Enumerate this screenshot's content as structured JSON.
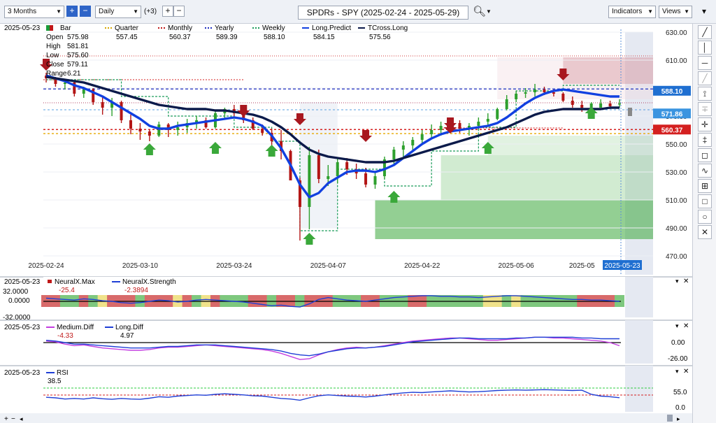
{
  "toolbar": {
    "period": "3 Months",
    "interval": "Daily",
    "extra": "(+3)",
    "symbol": "SPDRs - SPY (2025-02-24 - 2025-05-29)",
    "indicators_label": "Indicators",
    "views_label": "Views"
  },
  "legend": {
    "date": "2025-05-23",
    "bar_label": "Bar",
    "open_label": "Open",
    "open": "575.98",
    "high_label": "High",
    "high": "581.81",
    "low_label": "Low",
    "low": "575.60",
    "close_label": "Close",
    "close": "579.11",
    "range_label": "Range",
    "range": "6.21",
    "items": [
      {
        "name": "Quarter",
        "value": "557.45",
        "color": "#d6a600"
      },
      {
        "name": "Monthly",
        "value": "560.37",
        "color": "#c01818"
      },
      {
        "name": "Yearly",
        "value": "589.39",
        "color": "#1f2fbf"
      },
      {
        "name": "Weekly",
        "value": "588.10",
        "color": "#1b9c5a"
      },
      {
        "name": "Long.Predict",
        "value": "584.15",
        "color": "#1140e0"
      },
      {
        "name": "TCross.Long",
        "value": "575.56",
        "color": "#0b1a4a"
      }
    ]
  },
  "price_axis": [
    "630.00",
    "610.00",
    "590.00",
    "570.00",
    "550.00",
    "530.00",
    "510.00",
    "490.00",
    "470.00"
  ],
  "price_tags": [
    {
      "label": "588.10",
      "color": "#1f6fd1"
    },
    {
      "label": "571.86",
      "color": "#3a94e0"
    },
    {
      "label": "560.37",
      "color": "#d42020"
    }
  ],
  "date_axis": [
    "2025-02-24",
    "2025-03-10",
    "2025-03-24",
    "2025-04-07",
    "2025-04-22",
    "2025-05-06",
    "2025-05"
  ],
  "date_cursor": "2025-05-23",
  "panels": {
    "neural": {
      "date": "2025-05-23",
      "max_name": "NeuralX.Max",
      "max_value": "-25.4",
      "strength_name": "NeuralX.Strength",
      "strength_value": "-2.3894",
      "axis": [
        "32.0000",
        "0.0000",
        "-32.0000"
      ]
    },
    "diff": {
      "date": "2025-05-23",
      "medium_name": "Medium.Diff",
      "medium_value": "-4.33",
      "long_name": "Long.Diff",
      "long_value": "4.97",
      "axis": [
        "0.00",
        "-26.00"
      ]
    },
    "rsi": {
      "date": "2025-05-23",
      "name": "RSI",
      "value": "38.5",
      "axis": [
        "55.0",
        "0.0"
      ]
    }
  },
  "chart_data": {
    "type": "candlestick",
    "title": "SPDRs - SPY (2025-02-24 - 2025-05-29)",
    "ylim": [
      470,
      630
    ],
    "dates": [
      "2025-02-24",
      "2025-03-10",
      "2025-03-24",
      "2025-04-07",
      "2025-04-22",
      "2025-05-06",
      "2025-05-23"
    ],
    "bar_count": 62,
    "ohlc": [
      [
        599,
        601,
        594,
        597
      ],
      [
        597,
        598,
        591,
        593
      ],
      [
        593,
        596,
        589,
        594
      ],
      [
        594,
        595,
        584,
        586
      ],
      [
        586,
        591,
        583,
        589
      ],
      [
        589,
        590,
        578,
        580
      ],
      [
        580,
        584,
        571,
        576
      ],
      [
        576,
        583,
        570,
        580
      ],
      [
        580,
        581,
        565,
        567
      ],
      [
        567,
        571,
        557,
        561
      ],
      [
        561,
        565,
        553,
        559
      ],
      [
        559,
        560,
        552,
        556
      ],
      [
        556,
        566,
        555,
        564
      ],
      [
        564,
        565,
        555,
        560
      ],
      [
        560,
        566,
        556,
        562
      ],
      [
        562,
        568,
        558,
        565
      ],
      [
        565,
        570,
        561,
        567
      ],
      [
        567,
        569,
        561,
        562
      ],
      [
        562,
        574,
        561,
        572
      ],
      [
        572,
        576,
        568,
        575
      ],
      [
        575,
        578,
        570,
        572
      ],
      [
        572,
        573,
        565,
        567
      ],
      [
        567,
        569,
        560,
        561
      ],
      [
        561,
        564,
        556,
        558
      ],
      [
        558,
        561,
        548,
        552
      ],
      [
        552,
        560,
        539,
        545
      ],
      [
        545,
        546,
        525,
        524
      ],
      [
        524,
        526,
        481,
        505
      ],
      [
        505,
        548,
        489,
        542
      ],
      [
        542,
        546,
        522,
        525
      ],
      [
        525,
        535,
        520,
        527
      ],
      [
        527,
        540,
        522,
        537
      ],
      [
        537,
        540,
        528,
        532
      ],
      [
        532,
        536,
        525,
        529
      ],
      [
        529,
        533,
        519,
        521
      ],
      [
        521,
        530,
        518,
        527
      ],
      [
        527,
        541,
        525,
        539
      ],
      [
        539,
        548,
        535,
        546
      ],
      [
        546,
        552,
        541,
        549
      ],
      [
        549,
        555,
        544,
        553
      ],
      [
        553,
        560,
        550,
        557
      ],
      [
        557,
        564,
        554,
        560
      ],
      [
        560,
        566,
        556,
        563
      ],
      [
        563,
        567,
        558,
        565
      ],
      [
        565,
        567,
        558,
        561
      ],
      [
        561,
        565,
        556,
        563
      ],
      [
        563,
        569,
        560,
        566
      ],
      [
        566,
        572,
        563,
        568
      ],
      [
        568,
        576,
        567,
        575
      ],
      [
        575,
        585,
        574,
        582
      ],
      [
        582,
        588,
        580,
        586
      ],
      [
        586,
        590,
        583,
        587
      ],
      [
        587,
        593,
        584,
        589
      ],
      [
        589,
        591,
        585,
        587
      ],
      [
        587,
        589,
        584,
        586
      ],
      [
        586,
        587,
        580,
        581
      ],
      [
        581,
        584,
        576,
        578
      ],
      [
        578,
        581,
        573,
        576
      ],
      [
        576,
        580,
        573,
        579
      ],
      [
        576,
        582,
        576,
        579
      ],
      [
        579,
        581,
        575,
        577
      ],
      [
        579,
        582,
        576,
        579
      ]
    ],
    "series": [
      {
        "name": "Long.Predict",
        "values": [
          599,
          597,
          595,
          592,
          590,
          587,
          584,
          580,
          576,
          572,
          568,
          563,
          561,
          561,
          563,
          564,
          565,
          566,
          567,
          568,
          569,
          568,
          566,
          563,
          556,
          547,
          535,
          521,
          512,
          515,
          522,
          526,
          530,
          531,
          531,
          530,
          532,
          535,
          540,
          545,
          550,
          554,
          557,
          559,
          560,
          561,
          562,
          563,
          565,
          569,
          574,
          579,
          583,
          586,
          588,
          589,
          588,
          587,
          586,
          585,
          584,
          584
        ]
      },
      {
        "name": "TCross.Long",
        "values": [
          598,
          597,
          596,
          595,
          594,
          592,
          590,
          588,
          586,
          584,
          582,
          580,
          578,
          577,
          576,
          575,
          575,
          575,
          574,
          574,
          573,
          572,
          571,
          569,
          566,
          562,
          557,
          551,
          546,
          543,
          541,
          540,
          539,
          538,
          537,
          537,
          537,
          538,
          540,
          542,
          544,
          546,
          548,
          550,
          552,
          554,
          556,
          558,
          560,
          562,
          565,
          568,
          571,
          573,
          574,
          575,
          575,
          575,
          575,
          575,
          576,
          576
        ]
      }
    ],
    "levels": [
      {
        "name": "Quarter",
        "value": 557.45
      },
      {
        "name": "Monthly",
        "value": 560.37
      },
      {
        "name": "Yearly",
        "value": 589.39
      },
      {
        "name": "Weekly",
        "value": 588.1
      }
    ],
    "indicators": {
      "NeuralX.Max": -25.4,
      "NeuralX.Strength": -2.3894,
      "Medium.Diff": -4.33,
      "Long.Diff": 4.97,
      "RSI": 38.5
    }
  }
}
